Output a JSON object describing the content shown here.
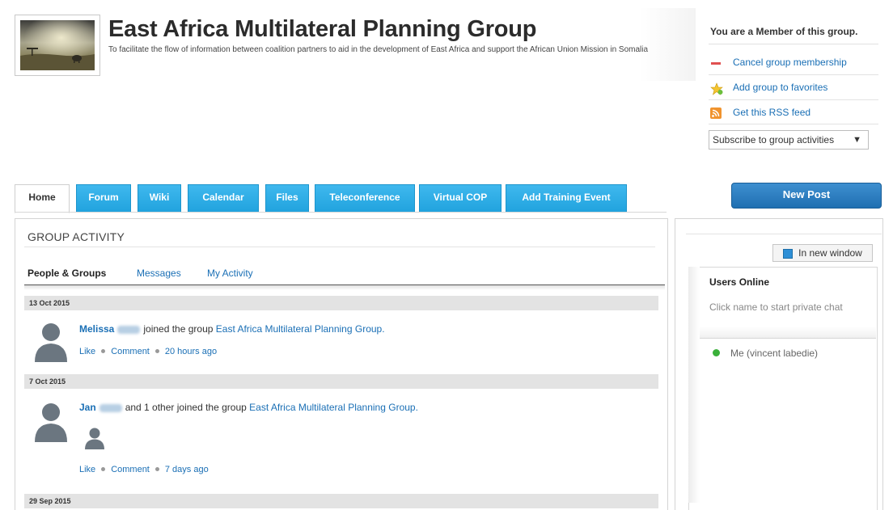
{
  "header": {
    "title": "East Africa Multilateral Planning Group",
    "description": "To facilitate the flow of information between coalition partners to aid in the development of East Africa and support the African Union Mission in Somalia"
  },
  "membership": {
    "status": "You are a Member of this group.",
    "actions": [
      {
        "label": "Cancel group membership",
        "icon": "minus-icon"
      },
      {
        "label": "Add group to favorites",
        "icon": "star-icon"
      },
      {
        "label": "Get this RSS feed",
        "icon": "rss-icon"
      }
    ],
    "subscribe_select": "Subscribe to group activities"
  },
  "tabs": [
    {
      "label": "Home",
      "active": true
    },
    {
      "label": "Forum"
    },
    {
      "label": "Wiki"
    },
    {
      "label": "Calendar"
    },
    {
      "label": "Files"
    },
    {
      "label": "Teleconference"
    },
    {
      "label": "Virtual COP"
    },
    {
      "label": "Add Training Event"
    }
  ],
  "new_post_label": "New Post",
  "activity": {
    "title": "GROUP ACTIVITY",
    "subtabs": [
      "People & Groups",
      "Messages",
      "My Activity"
    ],
    "dates": [
      "13 Oct 2015",
      "7 Oct 2015",
      "29 Sep 2015"
    ],
    "entries": [
      {
        "name": "Melissa",
        "text": "joined the group",
        "group": "East Africa Multilateral Planning Group.",
        "time": "20 hours ago"
      },
      {
        "name": "Jan",
        "text": "and 1 other joined the group",
        "group": "East Africa Multilateral Planning Group.",
        "time": "7 days ago"
      }
    ],
    "like_label": "Like",
    "comment_label": "Comment"
  },
  "chat": {
    "new_window_label": "In new window",
    "users_title": "Users Online",
    "users_hint": "Click name to start private chat",
    "users": [
      "Me (vincent labedie)"
    ]
  },
  "colors": {
    "tab_blue": "#2aaae5",
    "link_blue": "#1a6fb5",
    "online_green": "#3ab03a"
  }
}
